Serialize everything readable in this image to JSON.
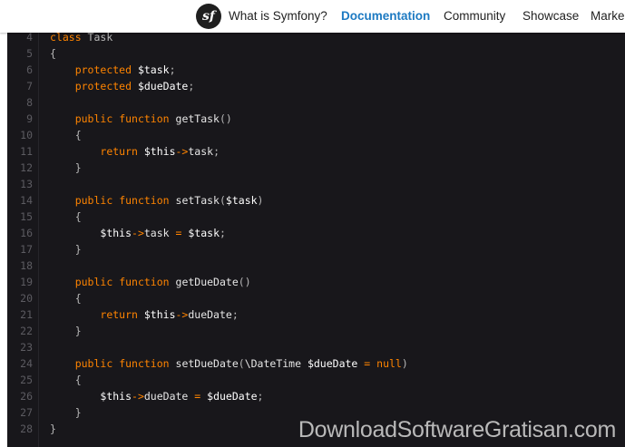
{
  "nav": {
    "logo_text": "sf",
    "items": [
      {
        "label": "What is Symfony?"
      },
      {
        "label": "Documentation",
        "active": true
      },
      {
        "label": "Community"
      },
      {
        "label": "Showcase"
      },
      {
        "label": "Marke"
      }
    ]
  },
  "colors": {
    "code_background": "#18171b",
    "keyword": "#ff8400",
    "active_nav": "#1d7ac2",
    "watermark": "#b9b9b9"
  },
  "code": {
    "line_numbers": [
      "4",
      "5",
      "6",
      "7",
      "8",
      "9",
      "10",
      "11",
      "12",
      "13",
      "14",
      "15",
      "16",
      "17",
      "18",
      "19",
      "20",
      "21",
      "22",
      "23",
      "24",
      "25",
      "26",
      "27",
      "28"
    ],
    "lines": [
      [
        {
          "t": "kw",
          "v": "class"
        },
        {
          "t": "pl",
          "v": " Task"
        }
      ],
      [
        {
          "t": "pl",
          "v": "{"
        }
      ],
      [
        {
          "t": "pl",
          "v": "    "
        },
        {
          "t": "kw",
          "v": "protected"
        },
        {
          "t": "pl",
          "v": " "
        },
        {
          "t": "var",
          "v": "$task"
        },
        {
          "t": "pl",
          "v": ";"
        }
      ],
      [
        {
          "t": "pl",
          "v": "    "
        },
        {
          "t": "kw",
          "v": "protected"
        },
        {
          "t": "pl",
          "v": " "
        },
        {
          "t": "var",
          "v": "$dueDate"
        },
        {
          "t": "pl",
          "v": ";"
        }
      ],
      [],
      [
        {
          "t": "pl",
          "v": "    "
        },
        {
          "t": "kw",
          "v": "public"
        },
        {
          "t": "pl",
          "v": " "
        },
        {
          "t": "kw",
          "v": "function"
        },
        {
          "t": "pl",
          "v": " "
        },
        {
          "t": "fn",
          "v": "getTask"
        },
        {
          "t": "pl",
          "v": "()"
        }
      ],
      [
        {
          "t": "pl",
          "v": "    {"
        }
      ],
      [
        {
          "t": "pl",
          "v": "        "
        },
        {
          "t": "kw",
          "v": "return"
        },
        {
          "t": "pl",
          "v": " "
        },
        {
          "t": "var",
          "v": "$this"
        },
        {
          "t": "op",
          "v": "->"
        },
        {
          "t": "fn",
          "v": "task"
        },
        {
          "t": "pl",
          "v": ";"
        }
      ],
      [
        {
          "t": "pl",
          "v": "    }"
        }
      ],
      [],
      [
        {
          "t": "pl",
          "v": "    "
        },
        {
          "t": "kw",
          "v": "public"
        },
        {
          "t": "pl",
          "v": " "
        },
        {
          "t": "kw",
          "v": "function"
        },
        {
          "t": "pl",
          "v": " "
        },
        {
          "t": "fn",
          "v": "setTask"
        },
        {
          "t": "pl",
          "v": "("
        },
        {
          "t": "var",
          "v": "$task"
        },
        {
          "t": "pl",
          "v": ")"
        }
      ],
      [
        {
          "t": "pl",
          "v": "    {"
        }
      ],
      [
        {
          "t": "pl",
          "v": "        "
        },
        {
          "t": "var",
          "v": "$this"
        },
        {
          "t": "op",
          "v": "->"
        },
        {
          "t": "fn",
          "v": "task"
        },
        {
          "t": "pl",
          "v": " "
        },
        {
          "t": "op",
          "v": "="
        },
        {
          "t": "pl",
          "v": " "
        },
        {
          "t": "var",
          "v": "$task"
        },
        {
          "t": "pl",
          "v": ";"
        }
      ],
      [
        {
          "t": "pl",
          "v": "    }"
        }
      ],
      [],
      [
        {
          "t": "pl",
          "v": "    "
        },
        {
          "t": "kw",
          "v": "public"
        },
        {
          "t": "pl",
          "v": " "
        },
        {
          "t": "kw",
          "v": "function"
        },
        {
          "t": "pl",
          "v": " "
        },
        {
          "t": "fn",
          "v": "getDueDate"
        },
        {
          "t": "pl",
          "v": "()"
        }
      ],
      [
        {
          "t": "pl",
          "v": "    {"
        }
      ],
      [
        {
          "t": "pl",
          "v": "        "
        },
        {
          "t": "kw",
          "v": "return"
        },
        {
          "t": "pl",
          "v": " "
        },
        {
          "t": "var",
          "v": "$this"
        },
        {
          "t": "op",
          "v": "->"
        },
        {
          "t": "fn",
          "v": "dueDate"
        },
        {
          "t": "pl",
          "v": ";"
        }
      ],
      [
        {
          "t": "pl",
          "v": "    }"
        }
      ],
      [],
      [
        {
          "t": "pl",
          "v": "    "
        },
        {
          "t": "kw",
          "v": "public"
        },
        {
          "t": "pl",
          "v": " "
        },
        {
          "t": "kw",
          "v": "function"
        },
        {
          "t": "pl",
          "v": " "
        },
        {
          "t": "fn",
          "v": "setDueDate"
        },
        {
          "t": "pl",
          "v": "("
        },
        {
          "t": "fn",
          "v": "\\DateTime"
        },
        {
          "t": "pl",
          "v": " "
        },
        {
          "t": "var",
          "v": "$dueDate"
        },
        {
          "t": "pl",
          "v": " "
        },
        {
          "t": "op",
          "v": "="
        },
        {
          "t": "pl",
          "v": " "
        },
        {
          "t": "nl",
          "v": "null"
        },
        {
          "t": "pl",
          "v": ")"
        }
      ],
      [
        {
          "t": "pl",
          "v": "    {"
        }
      ],
      [
        {
          "t": "pl",
          "v": "        "
        },
        {
          "t": "var",
          "v": "$this"
        },
        {
          "t": "op",
          "v": "->"
        },
        {
          "t": "fn",
          "v": "dueDate"
        },
        {
          "t": "pl",
          "v": " "
        },
        {
          "t": "op",
          "v": "="
        },
        {
          "t": "pl",
          "v": " "
        },
        {
          "t": "var",
          "v": "$dueDate"
        },
        {
          "t": "pl",
          "v": ";"
        }
      ],
      [
        {
          "t": "pl",
          "v": "    }"
        }
      ],
      [
        {
          "t": "pl",
          "v": "}"
        }
      ]
    ]
  },
  "watermark": "DownloadSoftwareGratisan.com"
}
